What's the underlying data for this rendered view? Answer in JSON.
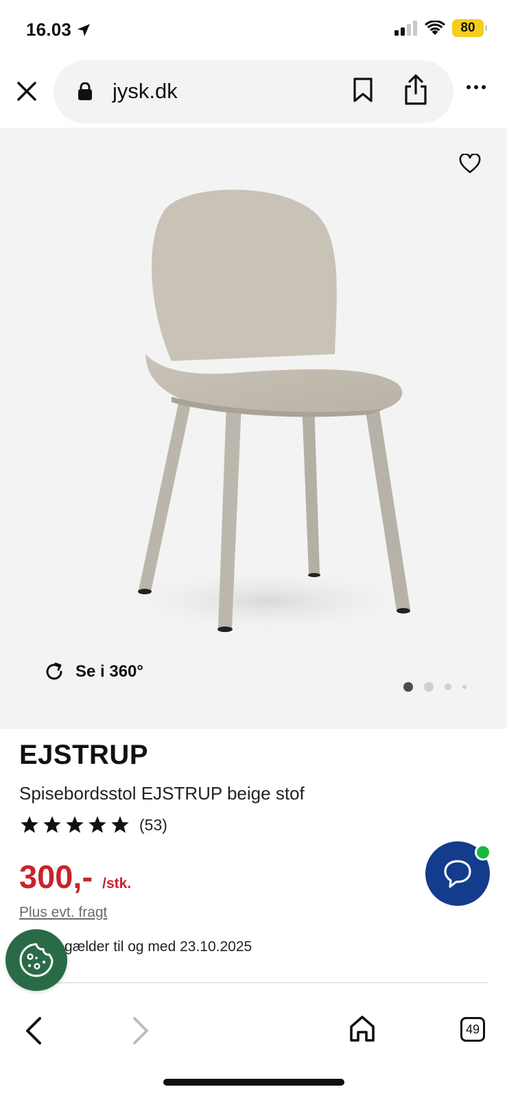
{
  "status_bar": {
    "time": "16.03",
    "battery": "80"
  },
  "browser": {
    "url": "jysk.dk",
    "tab_count": "49"
  },
  "gallery": {
    "view360_label": "Se i 360°",
    "slide_count": 4,
    "active_slide": 1
  },
  "product": {
    "brand": "EJSTRUP",
    "name": "Spisebordsstol EJSTRUP beige stof",
    "rating_stars": 5,
    "review_count": "(53)",
    "price": "300,-",
    "per_unit": "/stk.",
    "shipping_note": "Plus evt. fragt",
    "validity": "gælder til og med 23.10.2025"
  },
  "colors": {
    "price_red": "#c8232c",
    "chat_blue": "#143c8c",
    "cookie_green": "#2a6b47",
    "online_green": "#18b83c",
    "battery_yellow": "#f5cd1d",
    "image_bg": "#f3f3f3"
  },
  "icons": [
    "location-arrow-icon",
    "signal-icon",
    "wifi-icon",
    "close-icon",
    "lock-icon",
    "bookmark-icon",
    "share-icon",
    "more-icon",
    "heart-icon",
    "rotate-icon",
    "star-icon",
    "chat-icon",
    "cookie-icon",
    "back-icon",
    "forward-icon",
    "home-icon",
    "tabs-icon"
  ]
}
